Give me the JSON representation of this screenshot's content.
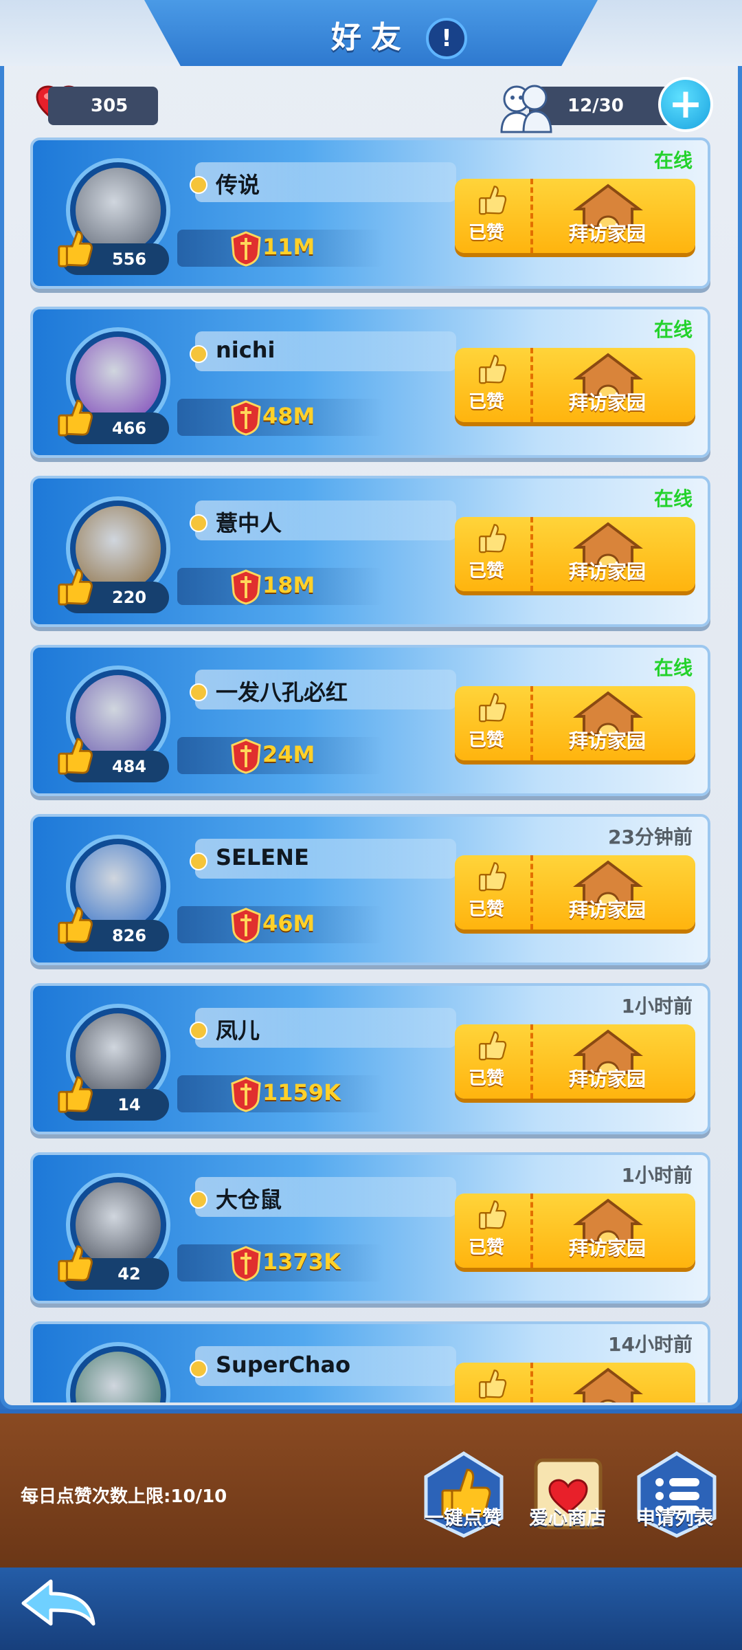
{
  "header": {
    "title": "好友",
    "info_icon": "exclamation-icon"
  },
  "stats": {
    "likes_received": "305",
    "friend_count": "12/30"
  },
  "friends": [
    {
      "name": "传说",
      "likes": "556",
      "power": "11M",
      "status": "在线",
      "online": true,
      "liked_label": "已赞",
      "visit_label": "拜访家园",
      "avatar_color": "#5a6270"
    },
    {
      "name": "nichi",
      "likes": "466",
      "power": "48M",
      "status": "在线",
      "online": true,
      "liked_label": "已赞",
      "visit_label": "拜访家园",
      "avatar_color": "#7a3fb8"
    },
    {
      "name": "薏中人",
      "likes": "220",
      "power": "18M",
      "status": "在线",
      "online": true,
      "liked_label": "已赞",
      "visit_label": "拜访家园",
      "avatar_color": "#8a6a3a"
    },
    {
      "name": "一发八孔必红",
      "likes": "484",
      "power": "24M",
      "status": "在线",
      "online": true,
      "liked_label": "已赞",
      "visit_label": "拜访家园",
      "avatar_color": "#6a5ab0"
    },
    {
      "name": "SELENE",
      "likes": "826",
      "power": "46M",
      "status": "23分钟前",
      "online": false,
      "liked_label": "已赞",
      "visit_label": "拜访家园",
      "avatar_color": "#2f6ec8"
    },
    {
      "name": "凤儿",
      "likes": "14",
      "power": "1159K",
      "status": "1小时前",
      "online": false,
      "liked_label": "已赞",
      "visit_label": "拜访家园",
      "avatar_color": "#3e4450"
    },
    {
      "name": "大仓鼠",
      "likes": "42",
      "power": "1373K",
      "status": "1小时前",
      "online": false,
      "liked_label": "已赞",
      "visit_label": "拜访家园",
      "avatar_color": "#404652"
    },
    {
      "name": "SuperChao",
      "likes": "",
      "power": "",
      "status": "14小时前",
      "online": false,
      "liked_label": "",
      "visit_label": "",
      "avatar_color": "#2f6a5a"
    }
  ],
  "bottom": {
    "daily_limit": "每日点赞次数上限:10/10",
    "like_all_label": "一键点赞",
    "heart_shop_label": "爱心商店",
    "request_list_label": "申请列表"
  },
  "colors": {
    "online": "#23d22b",
    "offline": "#555e66",
    "power": "#ffd12a"
  }
}
